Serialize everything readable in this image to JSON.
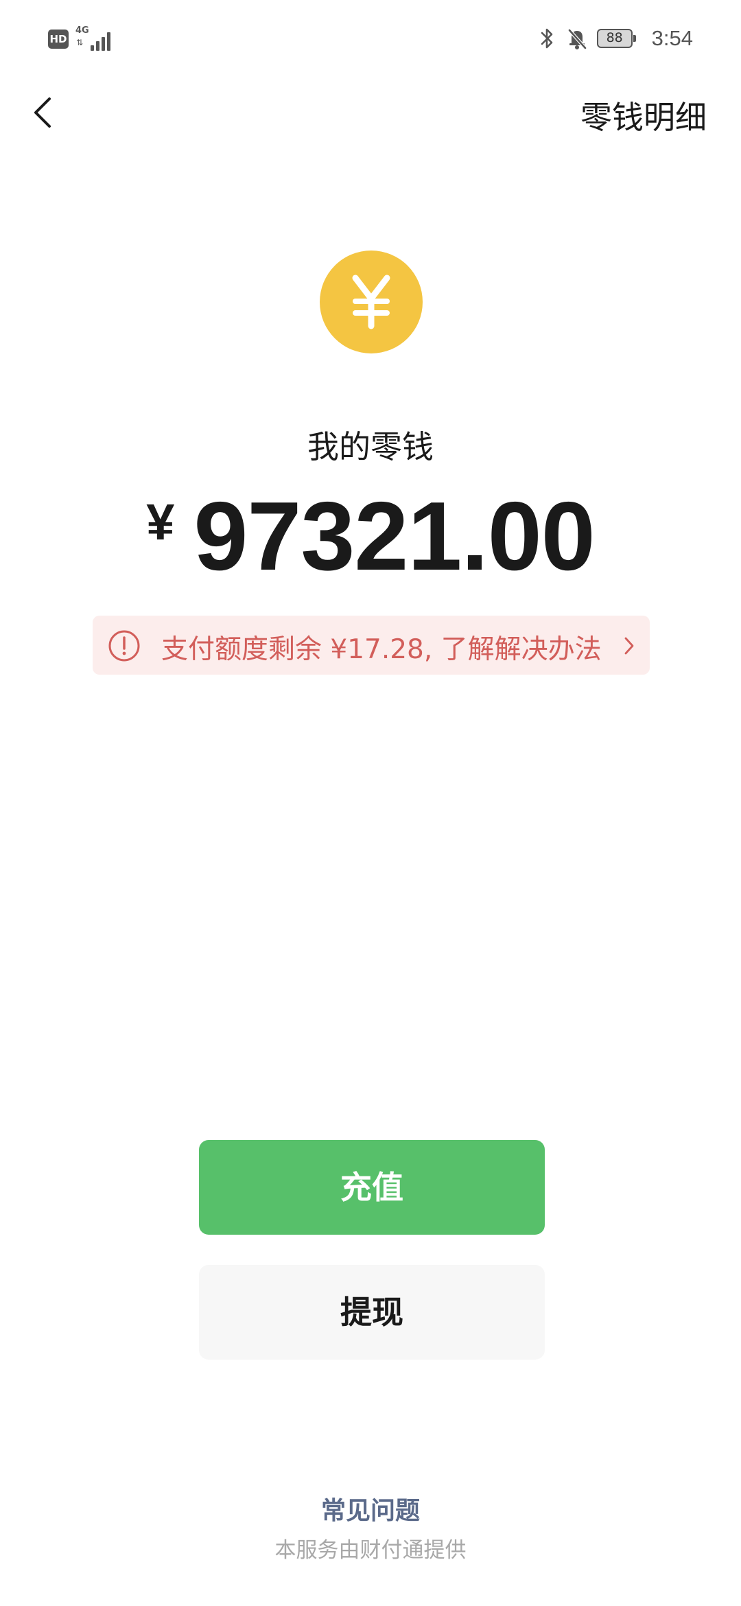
{
  "status_bar": {
    "hd_badge": "HD",
    "network": "4G",
    "battery": "88",
    "time": "3:54",
    "icons": [
      "hd-badge",
      "signal-icon",
      "bluetooth-icon",
      "mute-bell-icon",
      "battery-icon"
    ]
  },
  "nav": {
    "back_icon": "chevron-left-icon",
    "title_link": "零钱明细"
  },
  "wallet": {
    "coin_icon": "yuan-coin-icon",
    "coin_color": "#f4c542",
    "label": "我的零钱",
    "currency": "¥",
    "amount": "97321.00"
  },
  "notice": {
    "icon": "alert-circle-icon",
    "text": "支付额度剩余 ¥17.28, 了解解决办法",
    "chevron_icon": "chevron-right-icon",
    "color": "#d25e5a",
    "background": "#fcedec"
  },
  "actions": {
    "recharge_label": "充值",
    "recharge_color": "#57c06a",
    "withdraw_label": "提现"
  },
  "footer": {
    "faq_label": "常见问题",
    "provider_text": "本服务由财付通提供"
  }
}
